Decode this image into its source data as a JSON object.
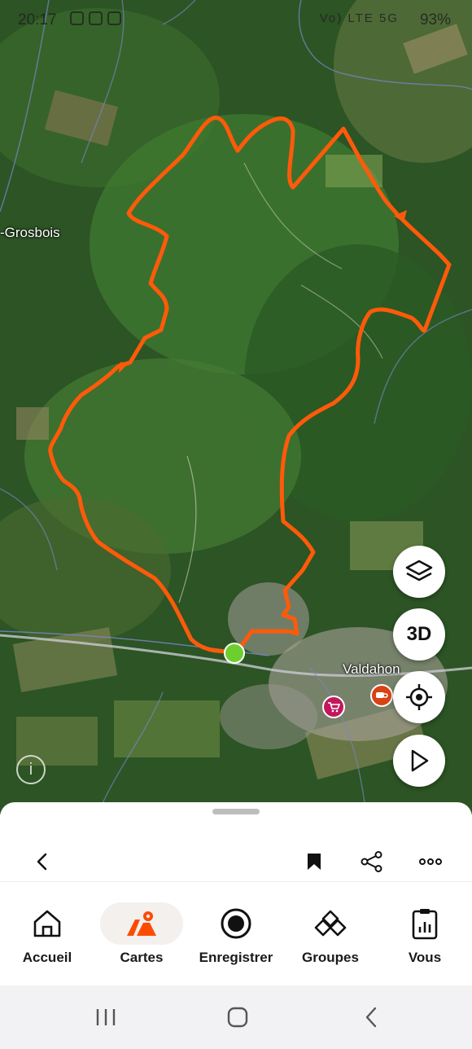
{
  "status_bar": {
    "time": "20:17",
    "network": "Vo) LTE 5G",
    "battery": "93%"
  },
  "map": {
    "place_labels": [
      "-Grosbois",
      "Valdahon"
    ],
    "route_color": "#ff5a0a",
    "start_color": "#6ccf2e",
    "buttons": {
      "layers_icon": "layers-icon",
      "three_d_label": "3D",
      "locate_icon": "crosshair-icon",
      "play_icon": "play-icon"
    },
    "pois": [
      {
        "icon": "shopping-cart-icon",
        "color": "#c2185b"
      },
      {
        "icon": "coffee-cup-icon",
        "color": "#d84315"
      }
    ],
    "info_label": "i"
  },
  "sheet_toolbar": {
    "back_icon": "chevron-left-icon",
    "bookmark_icon": "bookmark-icon",
    "share_icon": "share-icon",
    "more_icon": "more-icon"
  },
  "bottom_nav": {
    "items": [
      {
        "label": "Accueil",
        "icon": "home-icon"
      },
      {
        "label": "Cartes",
        "icon": "map-icon",
        "active": true
      },
      {
        "label": "Enregistrer",
        "icon": "record-icon"
      },
      {
        "label": "Groupes",
        "icon": "groups-icon"
      },
      {
        "label": "Vous",
        "icon": "stats-clipboard-icon"
      }
    ],
    "accent": "#fc4c02"
  },
  "system_nav": {
    "recent_icon": "recent-apps-icon",
    "home_icon": "home-circle-icon",
    "back_icon": "back-icon"
  }
}
